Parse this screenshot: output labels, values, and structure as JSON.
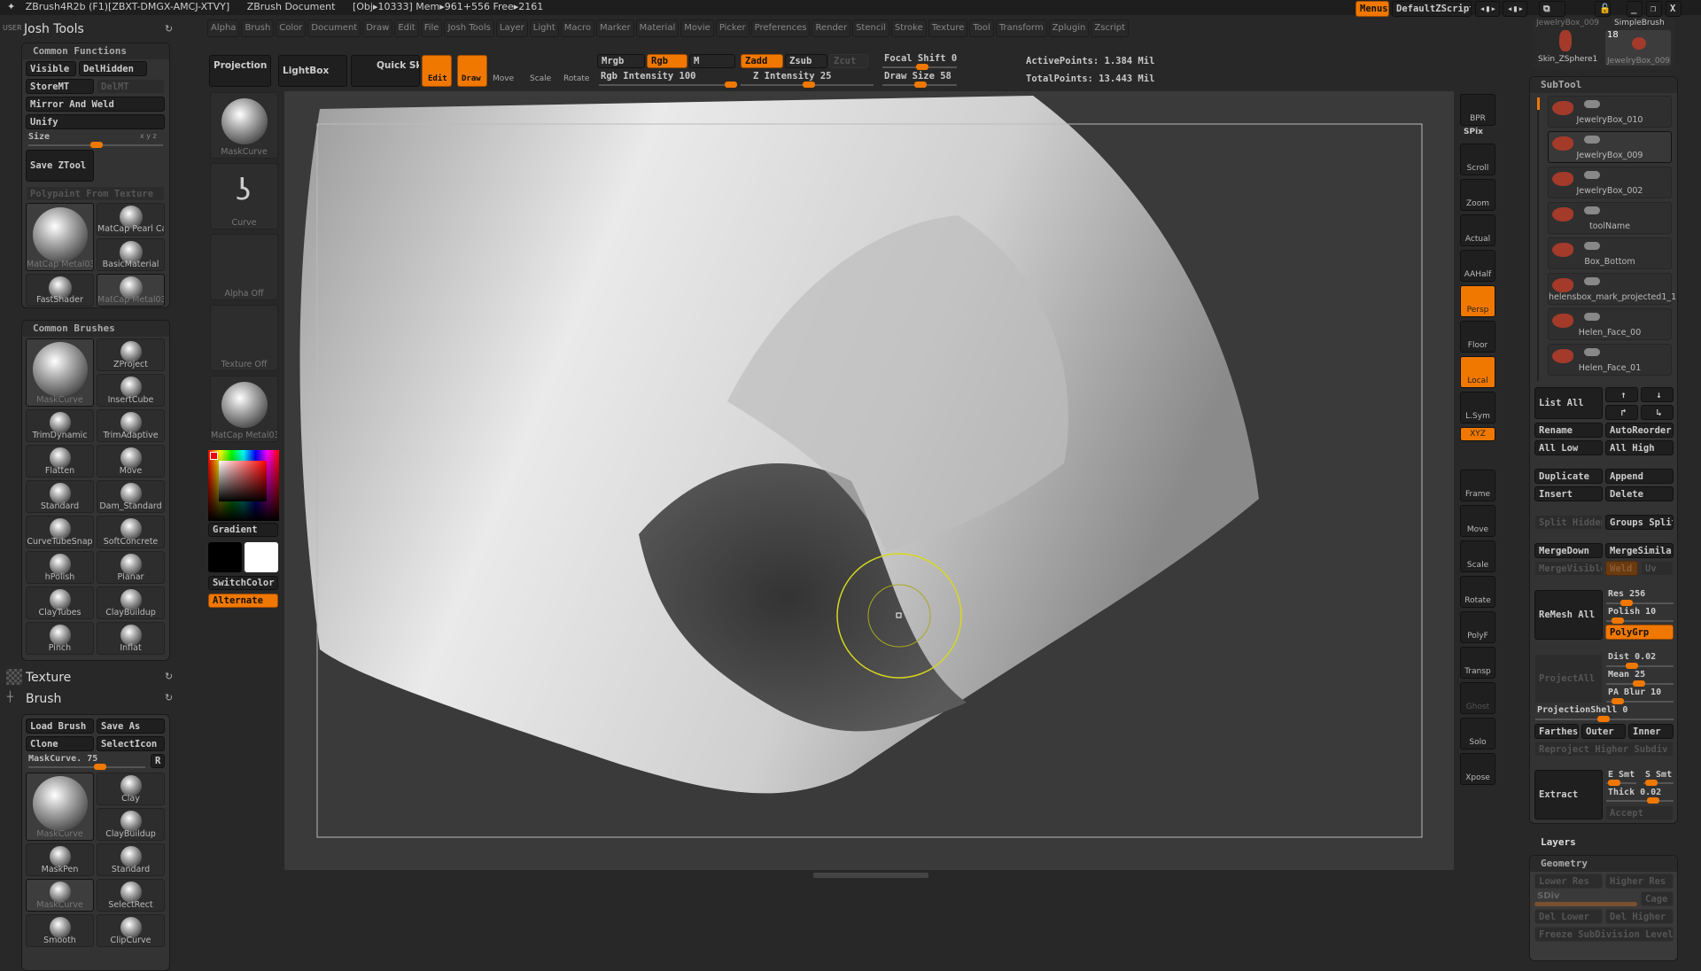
{
  "title_bar": {
    "app": "ZBrush4R2b (F1)[ZBXT-DMGX-AMCJ-XTVY]",
    "document": "ZBrush Document",
    "stats": "[Obj▸10333] Mem▸961+556 Free▸2161"
  },
  "top_right": {
    "menus": "Menus",
    "script": "DefaultZScript"
  },
  "menu_bar": [
    "Alpha",
    "Brush",
    "Color",
    "Document",
    "Draw",
    "Edit",
    "File",
    "Josh Tools",
    "Layer",
    "Light",
    "Macro",
    "Marker",
    "Material",
    "Movie",
    "Picker",
    "Preferences",
    "Render",
    "Stencil",
    "Stroke",
    "Texture",
    "Tool",
    "Transform",
    "Zplugin",
    "Zscript"
  ],
  "toolbar": {
    "projection_master": "Projection Master",
    "lightbox": "LightBox",
    "quick_sketch": "Quick Sketch",
    "edit": "Edit",
    "draw": "Draw",
    "move": "Move",
    "scale": "Scale",
    "rotate": "Rotate",
    "mrgb": "Mrgb",
    "rgb": "Rgb",
    "m": "M",
    "zadd": "Zadd",
    "zsub": "Zsub",
    "zcut": "Zcut",
    "rgb_intensity": "Rgb Intensity 100",
    "z_intensity": "Z Intensity 25",
    "focal_shift": "Focal Shift 0",
    "draw_size": "Draw Size 58",
    "active_points": "ActivePoints: 1.384 Mil",
    "total_points": "TotalPoints: 13.443 Mil",
    "rgb_intensity_value": 100,
    "z_intensity_value": 25,
    "focal_shift_value": 0,
    "draw_size_value": 58
  },
  "left": {
    "user": "USER",
    "title": "Josh Tools",
    "common_functions": {
      "title": "Common Functions",
      "visible": "Visible",
      "delhidden": "DelHidden",
      "storemt": "StoreMT",
      "delmt": "DelMT",
      "mirror": "Mirror And Weld",
      "unify": "Unify",
      "size": "Size",
      "xyz": "x y z",
      "save": "Save ZTool",
      "polypaint": "Polypaint From Texture",
      "materials": [
        "MatCap Metal03",
        "MatCap Pearl Ca",
        "BasicMaterial",
        "FastShader",
        "MatCap Metal03"
      ]
    },
    "common_brushes": {
      "title": "Common Brushes",
      "items": [
        "MaskCurve",
        "ZProject",
        "InsertCube",
        "TrimDynamic",
        "TrimAdaptive",
        "Flatten",
        "Move",
        "Standard",
        "Dam_Standard",
        "CurveTubeSnap",
        "SoftConcrete",
        "hPolish",
        "Planar",
        "ClayTubes",
        "ClayBuildup",
        "Pinch",
        "Inflat"
      ]
    },
    "texture": "Texture",
    "brush": "Brush",
    "brush_panel": {
      "load": "Load Brush",
      "save_as": "Save As",
      "clone": "Clone",
      "select_icon": "SelectIcon",
      "slider": "MaskCurve. 75",
      "slider_value": 75,
      "r": "R",
      "items": [
        "MaskCurve",
        "Clay",
        "ClayBuildup",
        "MaskPen",
        "Standard",
        "MaskCurve",
        "SelectRect",
        "Smooth",
        "ClipCurve"
      ]
    }
  },
  "shelf": {
    "thumbs": [
      "MaskCurve",
      "Curve",
      "Alpha Off",
      "Texture Off",
      "MatCap Metal03"
    ],
    "gradient": "Gradient",
    "switch_color": "SwitchColor",
    "alternate": "Alternate",
    "main_color": "#000000",
    "secondary_color": "#ffffff",
    "accent": "#f07800"
  },
  "right_shelf": [
    "BPR",
    "SPix",
    "Scroll",
    "Zoom",
    "Actual",
    "AAHalf",
    "Persp",
    "Floor",
    "Local",
    "L.Sym",
    "XYZ",
    "Frame",
    "Move",
    "Scale",
    "Rotate",
    "PolyF",
    "Transp",
    "Ghost",
    "Solo",
    "Xpose"
  ],
  "tool_thumbs": {
    "top": [
      "JewelryBox_009",
      "SimpleBrush"
    ],
    "items": [
      "Skin_ZSphere1",
      "JewelryBox_009"
    ],
    "count": "18"
  },
  "subtool": {
    "title": "SubTool",
    "items": [
      "JewelryBox_010",
      "JewelryBox_009",
      "JewelryBox_002",
      "toolName",
      "Box_Bottom",
      "helensbox_mark_projected1_1",
      "Helen_Face_00",
      "Helen_Face_01"
    ],
    "list_all": "List All",
    "rename": "Rename",
    "autoreorder": "AutoReorder",
    "all_low": "All Low",
    "all_high": "All High",
    "duplicate": "Duplicate",
    "append": "Append",
    "insert": "Insert",
    "delete": "Delete",
    "split_hidden": "Split Hidden",
    "groups_split": "Groups Split",
    "mergedown": "MergeDown",
    "mergesimilar": "MergeSimilar",
    "mergevisible": "MergeVisible",
    "weld": "Weld",
    "uv": "Uv",
    "remesh_all": "ReMesh All",
    "res": "Res 256",
    "polish": "Polish 10",
    "polygrp": "PolyGrp",
    "projectall": "ProjectAll",
    "dist": "Dist 0.02",
    "mean": "Mean 25",
    "pa_blur": "PA Blur 10",
    "projection_shell": "ProjectionShell 0",
    "farthest": "Farthest",
    "outer": "Outer",
    "inner": "Inner",
    "reproject": "Reproject Higher Subdiv",
    "extract": "Extract",
    "e_smt": "E Smt",
    "s_smt": "S Smt",
    "thick": "Thick 0.02",
    "accept": "Accept"
  },
  "layers": "Layers",
  "geometry": {
    "title": "Geometry",
    "lower_res": "Lower Res",
    "higher_res": "Higher Res",
    "sdiv": "SDiv",
    "cage": "Cage",
    "del_lower": "Del Lower",
    "del_higher": "Del Higher",
    "freeze": "Freeze SubDivision Levels"
  }
}
